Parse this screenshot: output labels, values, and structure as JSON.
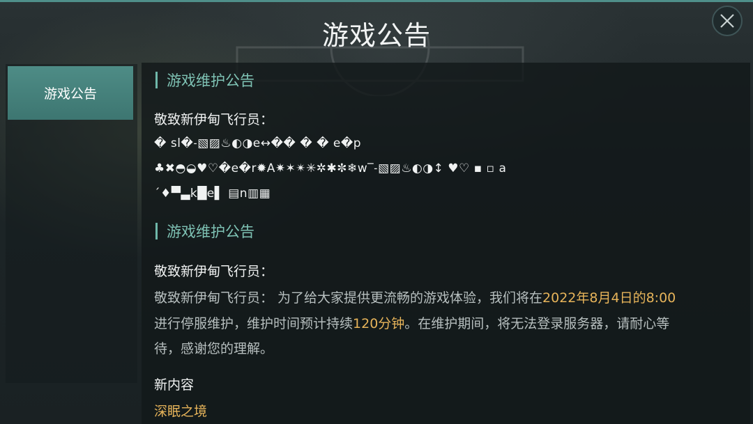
{
  "header": {
    "title": "游戏公告"
  },
  "sidebar": {
    "tabs": [
      {
        "label": "游戏公告"
      }
    ]
  },
  "sections": [
    {
      "heading": "游戏维护公告",
      "greeting": "敬致新伊甸飞行员：",
      "garbled_lines": [
        "� sl�˗▧▨♨◐◑e↔�� � � e�p",
        "♣✖◓◒♥♡�e�r✹A✷✶✴✳✲✱✼❄w‾˗▧▨♨◐◑↕ ♥♡ ▪  ▫ a",
        "ˊ♦▀▃k█e▌ ▤n▥▦"
      ]
    },
    {
      "heading": "游戏维护公告",
      "greeting": "敬致新伊甸飞行员：",
      "body": {
        "l1_a": "敬致新伊甸飞行员： 为了给大家提供更流畅的游戏体验，我们将在",
        "l1_hl": "2022年8月4日的8:00",
        "l2_a": "进行停服维护，维护时间预计持续",
        "l2_hl": "120分钟",
        "l2_b": "。在维护期间，将无法登录服务器，请耐心等",
        "l3": "待，感谢您的理解。"
      },
      "new_content_title": "新内容",
      "new_content_item": "深眠之境"
    }
  ],
  "colors": {
    "accent": "#4f8f8a",
    "highlight": "#e7b45a",
    "heading": "#7fc3b5"
  },
  "icons": {
    "close": "close-icon"
  }
}
